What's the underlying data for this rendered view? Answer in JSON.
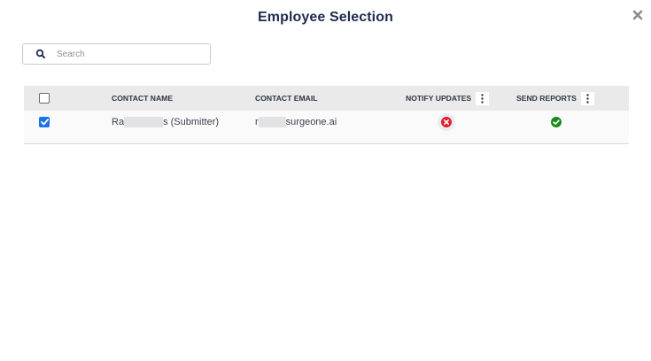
{
  "dialog": {
    "title": "Employee Selection"
  },
  "search": {
    "placeholder": "Search",
    "value": ""
  },
  "table": {
    "columns": {
      "name": "CONTACT NAME",
      "email": "CONTACT EMAIL",
      "notify": "NOTIFY UPDATES",
      "reports": "SEND REPORTS"
    },
    "rows": [
      {
        "selected": true,
        "name_prefix": "Ra",
        "name_suffix": "s (Submitter)",
        "email_prefix": "r",
        "email_suffix": "surgeone.ai",
        "notify_updates": "error-icon",
        "send_reports": "check-icon"
      }
    ]
  },
  "colors": {
    "title": "#1e2d4f",
    "header_bg": "#eaeaea",
    "checkbox_accent": "#1a73e8",
    "error": "#e0202a",
    "success": "#1b8a1b"
  }
}
